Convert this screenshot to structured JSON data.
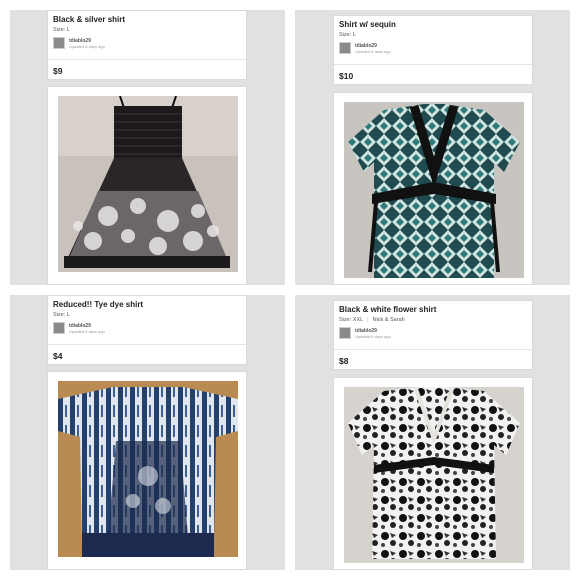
{
  "listings": [
    {
      "title": "Black & silver shirt",
      "size": "Size: L",
      "brand": "",
      "seller": "tdiablo29",
      "updated": "Updated 8 days ago",
      "price": "$9",
      "photo_icon": "black-silver-dress-photo"
    },
    {
      "title": "Shirt w/ sequin",
      "size": "Size: L",
      "brand": "",
      "seller": "tdiablo29",
      "updated": "Updated 8 days ago",
      "price": "$10",
      "photo_icon": "geometric-shirt-photo"
    },
    {
      "title": "Reduced!! Tye dye shirt",
      "size": "Size: L",
      "brand": "",
      "seller": "tdiablo29",
      "updated": "Updated 8 days ago",
      "price": "$4",
      "photo_icon": "tie-dye-shirt-photo"
    },
    {
      "title": "Black & white flower shirt",
      "size": "Size: XXL",
      "brand": "Nick & Sarah",
      "seller": "tdiablo29",
      "updated": "Updated 8 days ago",
      "price": "$8",
      "photo_icon": "flower-shirt-photo"
    }
  ],
  "colors": {
    "background_panel": "#e3e1df",
    "card": "#ffffff",
    "text": "#222222"
  }
}
